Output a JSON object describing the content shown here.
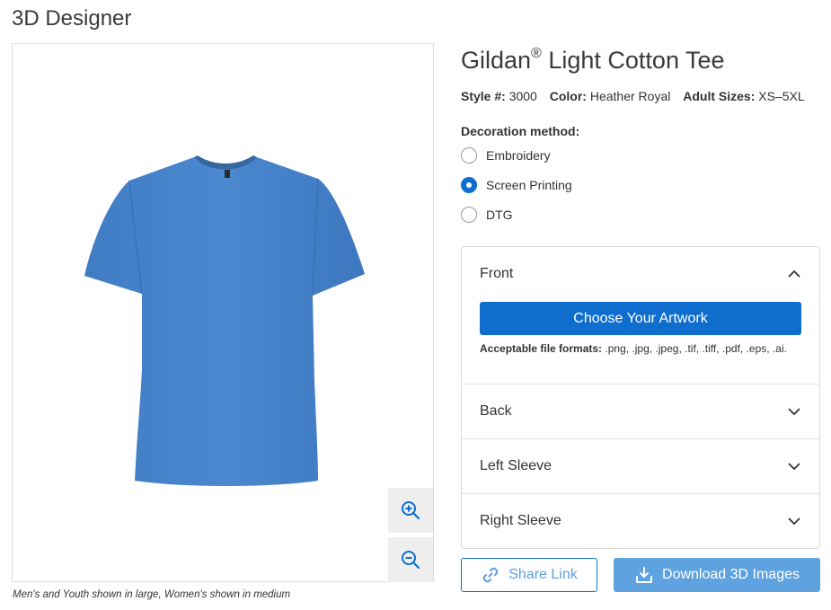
{
  "page": {
    "title": "3D Designer"
  },
  "viewer": {
    "caption": "Men's and Youth shown in large, Women's shown in medium",
    "zoom_in_icon": "zoom-in-icon",
    "zoom_out_icon": "zoom-out-icon",
    "shirt_color": "#4a86cc"
  },
  "product": {
    "brand": "Gildan",
    "registered": "®",
    "name": "Light Cotton Tee",
    "style_label": "Style #:",
    "style_value": "3000",
    "color_label": "Color:",
    "color_value": "Heather Royal",
    "sizes_label": "Adult Sizes:",
    "sizes_value": "XS–5XL"
  },
  "decoration": {
    "label": "Decoration method:",
    "options": [
      {
        "label": "Embroidery",
        "checked": false
      },
      {
        "label": "Screen Printing",
        "checked": true
      },
      {
        "label": "DTG",
        "checked": false
      }
    ]
  },
  "locations": {
    "front": {
      "label": "Front",
      "expanded": true,
      "button_label": "Choose Your Artwork",
      "formats_label": "Acceptable file formats:",
      "formats_value": ".png, .jpg, .jpeg, .tif, .tiff, .pdf, .eps, .ai."
    },
    "back": {
      "label": "Back",
      "expanded": false
    },
    "left_sleeve": {
      "label": "Left Sleeve",
      "expanded": false
    },
    "right_sleeve": {
      "label": "Right Sleeve",
      "expanded": false
    }
  },
  "actions": {
    "share_label": "Share Link",
    "download_label": "Download 3D Images"
  },
  "colors": {
    "primary": "#0f6ecd",
    "primary_light": "#5fa2e0",
    "border": "#d8d8d8"
  }
}
